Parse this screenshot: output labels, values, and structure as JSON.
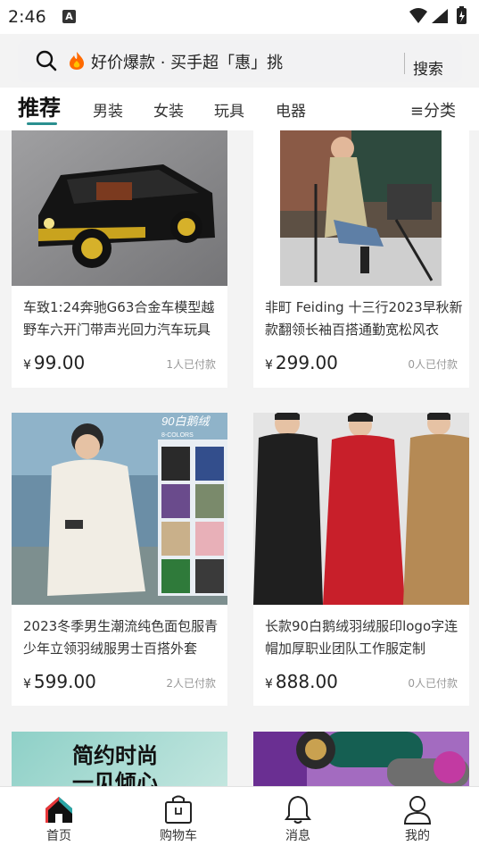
{
  "status_bar": {
    "time": "2:46",
    "notification_icon": "A"
  },
  "search": {
    "placeholder": "好价爆款 · 买手超「惠」挑",
    "button": "搜索"
  },
  "tabs": {
    "items": [
      "推荐",
      "男装",
      "女装",
      "玩具",
      "电器"
    ],
    "active": "推荐",
    "category": "≡分类"
  },
  "products": [
    {
      "title": "车致1:24奔驰G63合金车模型越野车六开门带声光回力汽车玩具",
      "currency": "¥",
      "price": "99.00",
      "sold": "1人已付款"
    },
    {
      "title": "非町 Feiding 十三行2023早秋新款翻领长袖百搭通勤宽松风衣",
      "currency": "¥",
      "price": "299.00",
      "sold": "0人已付款"
    },
    {
      "title": "2023冬季男生潮流纯色面包服青少年立领羽绒服男士百搭外套",
      "currency": "¥",
      "price": "599.00",
      "sold": "2人已付款"
    },
    {
      "title": "长款90白鹅绒羽绒服印logo字连帽加厚职业团队工作服定制",
      "currency": "¥",
      "price": "888.00",
      "sold": "0人已付款"
    },
    {
      "banner": "简约时尚 一见倾心"
    }
  ],
  "image_text": {
    "down_tag": "90白鹅绒",
    "colors": "8-COLORS"
  },
  "tabbar": {
    "home": "首页",
    "cart": "购物车",
    "messages": "消息",
    "mine": "我的"
  },
  "colors": {
    "accent": "#2a8f8f",
    "home_red": "#e8373a"
  }
}
